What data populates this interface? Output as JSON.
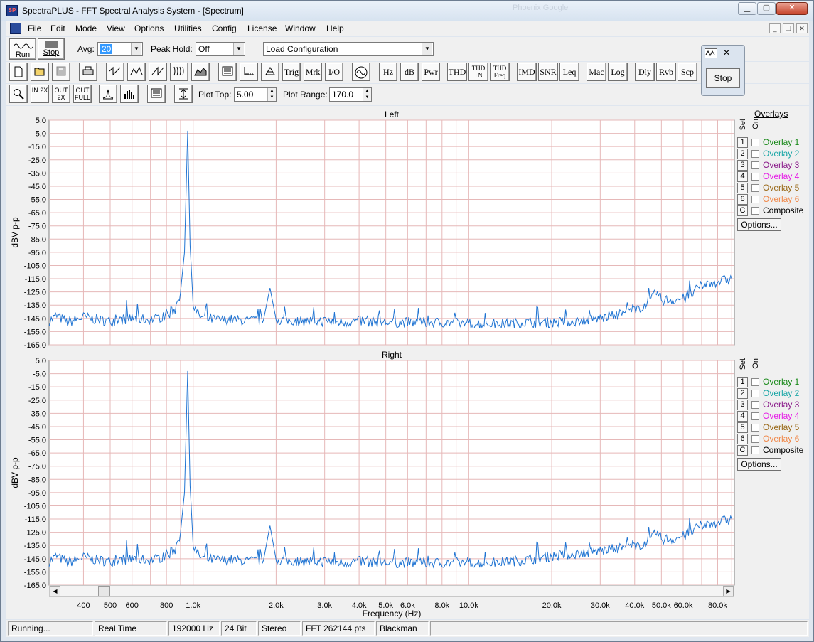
{
  "window": {
    "title": "SpectraPLUS - FFT Spectral Analysis System - [Spectrum]",
    "ghost_title": "Phoenix Google"
  },
  "menu": [
    "File",
    "Edit",
    "Mode",
    "View",
    "Options",
    "Utilities",
    "Config",
    "License",
    "Window",
    "Help"
  ],
  "toolbar1": {
    "run_label": "Run",
    "stop_label": "Stop",
    "avg_label": "Avg:",
    "avg_value": "20",
    "peak_hold_label": "Peak Hold:",
    "peak_hold_value": "Off",
    "config_value": "Load Configuration"
  },
  "toolbar2": {
    "text_buttons": [
      "Trig",
      "Mrk",
      "I/O",
      "Hz",
      "dB",
      "Pwr",
      "THD",
      "THD +N",
      "THD Freq",
      "IMD",
      "SNR",
      "Leq",
      "Mac",
      "Log",
      "Dly",
      "Rvb",
      "Scp"
    ]
  },
  "toolbar3": {
    "plot_top_label": "Plot Top:",
    "plot_top_value": "5.00",
    "plot_range_label": "Plot Range:",
    "plot_range_value": "170.0",
    "zoom_in_label": "IN 2X",
    "zoom_out_label": "OUT 2X",
    "zoom_full_label": "OUT FULL"
  },
  "float_window": {
    "stop_label": "Stop"
  },
  "overlays": {
    "title": "Overlays",
    "set_header": "Set",
    "on_header": "On",
    "options_label": "Options...",
    "items": [
      {
        "set": "1",
        "label": "Overlay 1",
        "color": "#1a8a1a"
      },
      {
        "set": "2",
        "label": "Overlay 2",
        "color": "#19a6a6"
      },
      {
        "set": "3",
        "label": "Overlay 3",
        "color": "#8a1a8a"
      },
      {
        "set": "4",
        "label": "Overlay 4",
        "color": "#e61ee6"
      },
      {
        "set": "5",
        "label": "Overlay 5",
        "color": "#9a6a1a"
      },
      {
        "set": "6",
        "label": "Overlay 6",
        "color": "#f0884a"
      },
      {
        "set": "C",
        "label": "Composite",
        "color": "#000000"
      }
    ]
  },
  "chart_data": [
    {
      "type": "line",
      "title": "Left",
      "ylabel": "dBV p-p",
      "ylim": [
        -165,
        5
      ],
      "yticks": [
        "5.0",
        "-5.0",
        "-15.0",
        "-25.0",
        "-35.0",
        "-45.0",
        "-55.0",
        "-65.0",
        "-75.0",
        "-85.0",
        "-95.0",
        "-105.0",
        "-115.0",
        "-125.0",
        "-135.0",
        "-145.0",
        "-155.0",
        "-165.0"
      ],
      "xscale": "log",
      "xlim": [
        300,
        92000
      ],
      "series": [
        {
          "color": "#1e73d2",
          "x": [
            300,
            320,
            350,
            400,
            450,
            500,
            600,
            700,
            800,
            860,
            900,
            930,
            955,
            975,
            1000,
            1050,
            1100,
            1200,
            1400,
            1600,
            1800,
            1900,
            2000,
            2500,
            3000,
            3500,
            4000,
            5000,
            6000,
            8000,
            10000,
            12000,
            14000,
            16000,
            20000,
            25000,
            30000,
            35000,
            40000,
            45000,
            48000,
            50000,
            55000,
            60000,
            65000,
            70000,
            80000,
            90000
          ],
          "y": [
            -147,
            -143,
            -148,
            -144,
            -146,
            -147,
            -145,
            -146,
            -143,
            -138,
            -125,
            -95,
            -3,
            -90,
            -135,
            -143,
            -145,
            -146,
            -146,
            -147,
            -146,
            -122,
            -146,
            -147,
            -147,
            -148,
            -147,
            -148,
            -148,
            -148,
            -149,
            -149,
            -149,
            -148,
            -148,
            -147,
            -145,
            -142,
            -138,
            -134,
            -125,
            -131,
            -131,
            -130,
            -126,
            -120,
            -117,
            -115
          ]
        }
      ]
    },
    {
      "type": "line",
      "title": "Right",
      "ylabel": "dBV p-p",
      "xlabel": "Frequency (Hz)",
      "ylim": [
        -165,
        5
      ],
      "yticks": [
        "5.0",
        "-5.0",
        "-15.0",
        "-25.0",
        "-35.0",
        "-45.0",
        "-55.0",
        "-65.0",
        "-75.0",
        "-85.0",
        "-95.0",
        "-105.0",
        "-115.0",
        "-125.0",
        "-135.0",
        "-145.0",
        "-155.0",
        "-165.0"
      ],
      "xscale": "log",
      "xlim": [
        300,
        92000
      ],
      "xticks": [
        {
          "v": 400,
          "label": "400"
        },
        {
          "v": 500,
          "label": "500"
        },
        {
          "v": 600,
          "label": "600"
        },
        {
          "v": 800,
          "label": "800"
        },
        {
          "v": 1000,
          "label": "1.0k"
        },
        {
          "v": 2000,
          "label": "2.0k"
        },
        {
          "v": 3000,
          "label": "3.0k"
        },
        {
          "v": 4000,
          "label": "4.0k"
        },
        {
          "v": 5000,
          "label": "5.0k"
        },
        {
          "v": 6000,
          "label": "6.0k"
        },
        {
          "v": 8000,
          "label": "8.0k"
        },
        {
          "v": 10000,
          "label": "10.0k"
        },
        {
          "v": 20000,
          "label": "20.0k"
        },
        {
          "v": 30000,
          "label": "30.0k"
        },
        {
          "v": 40000,
          "label": "40.0k"
        },
        {
          "v": 50000,
          "label": "50.0k"
        },
        {
          "v": 60000,
          "label": "60.0k"
        },
        {
          "v": 80000,
          "label": "80.0k"
        }
      ],
      "series": [
        {
          "color": "#1e73d2",
          "x": [
            300,
            320,
            350,
            400,
            450,
            500,
            600,
            700,
            800,
            860,
            900,
            930,
            955,
            975,
            1000,
            1050,
            1100,
            1200,
            1400,
            1600,
            1800,
            1900,
            2000,
            2500,
            3000,
            3500,
            4000,
            5000,
            6000,
            8000,
            10000,
            12000,
            14000,
            16000,
            20000,
            25000,
            30000,
            35000,
            40000,
            45000,
            48000,
            50000,
            55000,
            60000,
            65000,
            70000,
            80000,
            90000
          ],
          "y": [
            -147,
            -143,
            -148,
            -144,
            -146,
            -147,
            -145,
            -146,
            -143,
            -138,
            -125,
            -95,
            -3,
            -90,
            -135,
            -143,
            -145,
            -146,
            -146,
            -147,
            -146,
            -120,
            -146,
            -147,
            -147,
            -148,
            -147,
            -148,
            -148,
            -148,
            -148,
            -148,
            -147,
            -146,
            -143,
            -141,
            -139,
            -137,
            -135,
            -133,
            -125,
            -130,
            -130,
            -128,
            -124,
            -120,
            -117,
            -115
          ]
        }
      ]
    }
  ],
  "status_bar": [
    "Running...",
    "Real Time",
    "192000 Hz",
    "24 Bit",
    "Stereo",
    "FFT 262144 pts",
    "Blackman"
  ]
}
